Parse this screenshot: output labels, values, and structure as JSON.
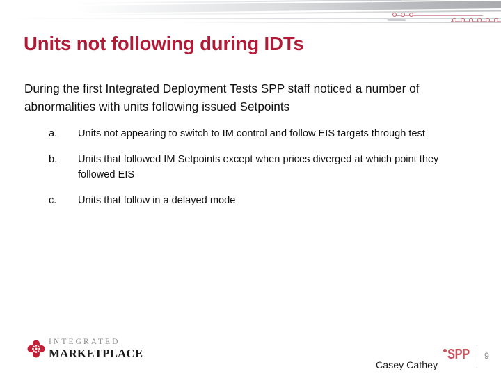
{
  "slide": {
    "title": "Units not following during IDTs",
    "body_paragraph": "During the first Integrated Deployment Tests SPP staff noticed a number of abnormalities with units following issued Setpoints",
    "list": [
      {
        "marker": "a.",
        "text": "Units not appearing to switch to IM control and follow EIS targets through test"
      },
      {
        "marker": "b.",
        "text": "Units that followed IM Setpoints except when prices diverged at which point they followed EIS"
      },
      {
        "marker": "c.",
        "text": "Units that follow in a delayed mode"
      }
    ]
  },
  "footer": {
    "logo_top": "INTEGRATED",
    "logo_bottom": "MARKETPLACE",
    "presenter": "Casey Cathey",
    "brand": "SPP",
    "page_number": "9"
  },
  "colors": {
    "title_red": "#B01C38",
    "brand_red": "#C8545F",
    "emblem_red": "#C21F36",
    "body_text": "#101010",
    "page_number_gray": "#8a8a8a"
  }
}
